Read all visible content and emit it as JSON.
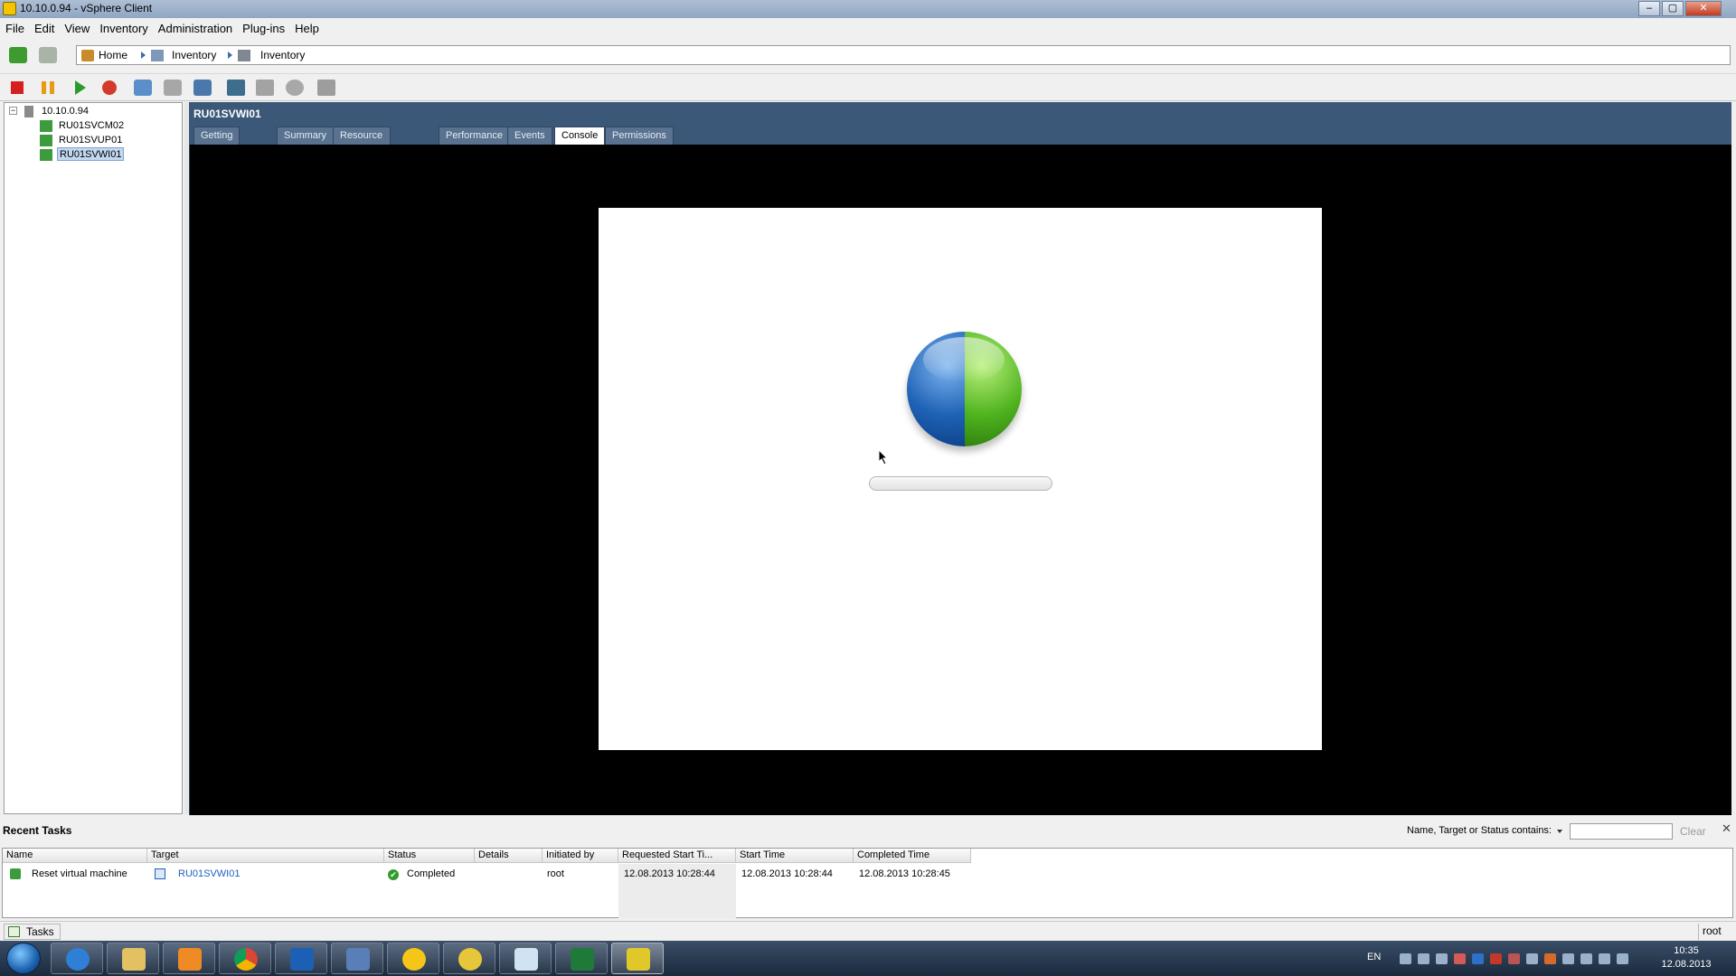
{
  "window": {
    "title": "10.10.0.94 - vSphere Client",
    "controls": {
      "minimize": "–",
      "maximize": "▢",
      "close": "✕"
    }
  },
  "menu": [
    "File",
    "Edit",
    "View",
    "Inventory",
    "Administration",
    "Plug-ins",
    "Help"
  ],
  "breadcrumb": [
    "Home",
    "Inventory",
    "Inventory"
  ],
  "toolbar": {
    "icons": [
      "stop-icon",
      "pause-icon",
      "play-icon",
      "reset-icon",
      "snapshot-icon",
      "revert-icon",
      "snapshot-manager-icon",
      "console-icon",
      "migrate-icon",
      "clone-icon",
      "template-icon"
    ]
  },
  "tree": {
    "root": "10.10.0.94",
    "expander": "−",
    "items": [
      "RU01SVCM02",
      "RU01SVUP01",
      "RU01SVWI01"
    ],
    "selected": "RU01SVWI01"
  },
  "vm": {
    "name": "RU01SVWI01",
    "tabs": [
      "Getting Started",
      "Summary",
      "Resource Allocation",
      "Performance",
      "Events",
      "Console",
      "Permissions"
    ],
    "active_tab": "Console"
  },
  "recent_tasks": {
    "title": "Recent Tasks",
    "filter_label": "Name, Target or Status contains:",
    "filter_value": "",
    "clear_label": "Clear",
    "close": "✕",
    "columns": [
      "Name",
      "Target",
      "Status",
      "Details",
      "Initiated by",
      "Requested Start Ti...",
      "Start Time",
      "Completed Time"
    ],
    "rows": [
      {
        "name": "Reset virtual machine",
        "target": "RU01SVWI01",
        "status": "Completed",
        "status_icon": "✔",
        "details": "",
        "initiated_by": "root",
        "requested_start": "12.08.2013 10:28:44",
        "start_time": "12.08.2013 10:28:44",
        "completed_time": "12.08.2013 10:28:45"
      }
    ]
  },
  "statusbar": {
    "tasks_label": "Tasks",
    "user": "root"
  },
  "taskbar": {
    "apps": [
      "internet-explorer",
      "windows-explorer",
      "media-player",
      "chrome",
      "outlook",
      "network-tool",
      "1c",
      "database-tool",
      "notepad",
      "excel",
      "vsphere-client"
    ],
    "active_app": "vsphere-client",
    "language": "EN",
    "time": "10:35",
    "date": "12.08.2013"
  },
  "colors": {
    "vm_header_bg": "#3b5878",
    "console_bg": "#000000",
    "link": "#1f5fbf",
    "status_ok": "#2e9d2e"
  }
}
